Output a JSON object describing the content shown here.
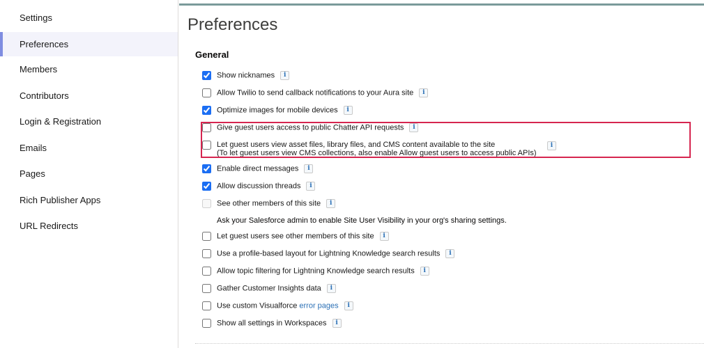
{
  "sidebar": {
    "items": [
      {
        "label": "Settings",
        "active": false
      },
      {
        "label": "Preferences",
        "active": true
      },
      {
        "label": "Members",
        "active": false
      },
      {
        "label": "Contributors",
        "active": false
      },
      {
        "label": "Login & Registration",
        "active": false
      },
      {
        "label": "Emails",
        "active": false
      },
      {
        "label": "Pages",
        "active": false
      },
      {
        "label": "Rich Publisher Apps",
        "active": false
      },
      {
        "label": "URL Redirects",
        "active": false
      }
    ]
  },
  "page": {
    "title": "Preferences",
    "section_title": "General",
    "info_glyph": "i"
  },
  "options": [
    {
      "label": "Show nicknames",
      "checked": true
    },
    {
      "label": "Allow Twilio to send callback notifications to your Aura site",
      "checked": false
    },
    {
      "label": "Optimize images for mobile devices",
      "checked": true
    },
    {
      "label": "Give guest users access to public Chatter API requests",
      "checked": false
    },
    {
      "label": "Let guest users view asset files, library files, and CMS content available to the site",
      "label2": "(To let guest users view CMS collections, also enable Allow guest users to access public APIs)",
      "checked": false
    },
    {
      "label": "Enable direct messages",
      "checked": true
    },
    {
      "label": "Allow discussion threads",
      "checked": true
    },
    {
      "label": "See other members of this site",
      "checked": false,
      "disabled": true
    },
    {
      "label": "Let guest users see other members of this site",
      "checked": false
    },
    {
      "label": "Use a profile-based layout for Lightning Knowledge search results",
      "checked": false
    },
    {
      "label": "Allow topic filtering for Lightning Knowledge search results",
      "checked": false
    },
    {
      "label": "Gather Customer Insights data",
      "checked": false
    },
    {
      "label": "Use custom Visualforce ",
      "link": "error pages",
      "checked": false
    },
    {
      "label": "Show all settings in Workspaces",
      "checked": false
    }
  ],
  "note": "Ask your Salesforce admin to enable Site User Visibility in your org's sharing settings.",
  "colors": {
    "accent": "#7f8de1",
    "highlight_border": "#d6254f",
    "link": "#2a6fb5"
  }
}
